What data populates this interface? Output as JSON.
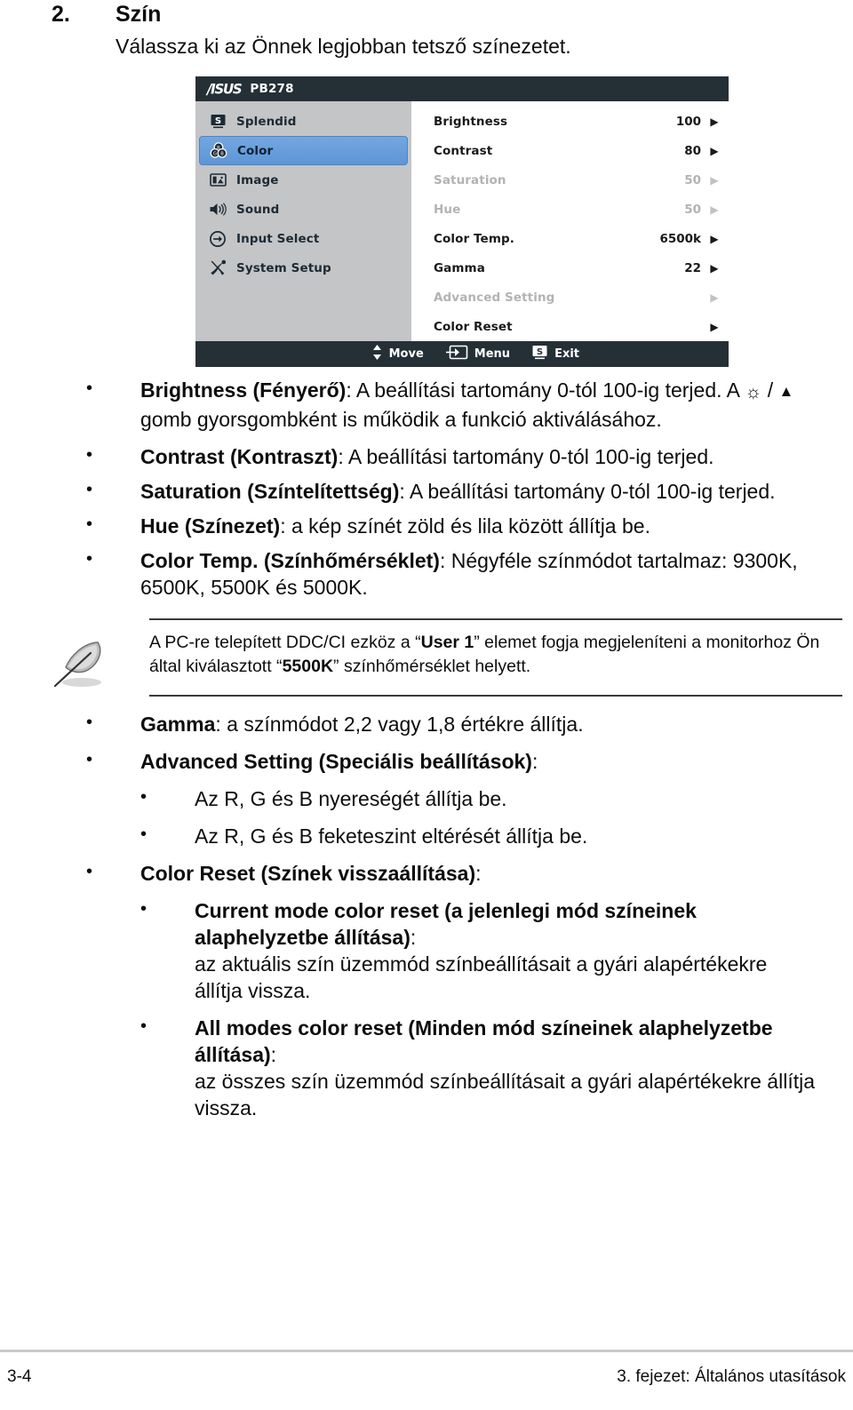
{
  "heading": {
    "number": "2.",
    "title": "Szín",
    "subtitle": "Válassza ki az Önnek legjobban tetsző színezetet."
  },
  "osd": {
    "brand": "/ISUS",
    "model": "PB278",
    "sidebar": [
      {
        "label": "Splendid",
        "icon": "splendid-icon",
        "active": false
      },
      {
        "label": "Color",
        "icon": "color-rgb-icon",
        "active": true
      },
      {
        "label": "Image",
        "icon": "image-icon",
        "active": false
      },
      {
        "label": "Sound",
        "icon": "speaker-icon",
        "active": false
      },
      {
        "label": "Input Select",
        "icon": "input-select-icon",
        "active": false
      },
      {
        "label": "System Setup",
        "icon": "tools-icon",
        "active": false
      }
    ],
    "rows": [
      {
        "label": "Brightness",
        "value": "100",
        "dim": false
      },
      {
        "label": "Contrast",
        "value": "80",
        "dim": false
      },
      {
        "label": "Saturation",
        "value": "50",
        "dim": true
      },
      {
        "label": "Hue",
        "value": "50",
        "dim": true
      },
      {
        "label": "Color Temp.",
        "value": "6500k",
        "dim": false
      },
      {
        "label": "Gamma",
        "value": "22",
        "dim": false
      },
      {
        "label": "Advanced Setting",
        "value": "",
        "dim": true
      },
      {
        "label": "Color Reset",
        "value": "",
        "dim": false
      }
    ],
    "footer": [
      {
        "label": "Move",
        "icon": "up-down-arrows-icon"
      },
      {
        "label": "Menu",
        "icon": "menu-enter-icon"
      },
      {
        "label": "Exit",
        "icon": "splendid-s-icon"
      }
    ]
  },
  "bullets": {
    "brightness_bold": "Brightness (Fényerő)",
    "brightness_rest": ": A beállítási tartomány 0-tól 100-ig terjed. A ",
    "brightness_tail": " gomb gyorsgombként is működik a funkció aktiválásához.",
    "sun_icon": "☼",
    "slash": " / ",
    "triangle_icon": "▲",
    "contrast_bold": "Contrast (Kontraszt)",
    "contrast_rest": ": A beállítási tartomány 0-tól 100-ig terjed.",
    "saturation_bold": "Saturation (Színtelítettség)",
    "saturation_rest": ": A beállítási tartomány 0-tól 100-ig terjed.",
    "hue_bold": "Hue (Színezet)",
    "hue_rest": ": a kép színét zöld és lila között állítja be.",
    "colortemp_bold": "Color Temp. (Színhőmérséklet)",
    "colortemp_rest": ": Négyféle színmódot tartalmaz: 9300K, 6500K, 5500K és 5000K.",
    "gamma_bold": "Gamma",
    "gamma_rest": ": a színmódot 2,2 vagy 1,8 értékre állítja.",
    "advanced_bold": "Advanced Setting (Speciális beállítások)",
    "advanced_rest": ":",
    "advanced_sub1": "Az R, G és B nyereségét állítja be.",
    "advanced_sub2": "Az R, G és B feketeszint eltérését állítja be.",
    "colorreset_bold": "Color Reset (Színek visszaállítása)",
    "colorreset_rest": ":",
    "current_mode_bold": "Current mode color reset (a jelenlegi mód színeinek alaphelyzetbe állítása)",
    "current_mode_colon": ":",
    "current_mode_body": "az aktuális szín üzemmód színbeállításait a gyári alapértékekre állítja vissza.",
    "all_modes_bold": "All modes color reset (Minden mód színeinek alaphelyzetbe állítása)",
    "all_modes_colon": ":",
    "all_modes_body": "az összes szín üzemmód színbeállításait a gyári alapértékekre állítja vissza.",
    "dot": "•"
  },
  "note": {
    "part1": "A PC-re telepített DDC/CI ezköz a “",
    "bold1": "User 1",
    "part2": "” elemet fogja megjeleníteni a monitorhoz Ön által kiválasztott “",
    "bold2": "5500K",
    "part3": "” színhőmérséklet helyett."
  },
  "footer": {
    "page": "3-4",
    "chapter": "3. fejezet: Általános utasítások"
  },
  "colors": {
    "osd_dark": "#252f36",
    "osd_sidebar": "#c3c5c7",
    "osd_highlight": "#5d95d6",
    "dim_text": "#b1b3b5"
  }
}
